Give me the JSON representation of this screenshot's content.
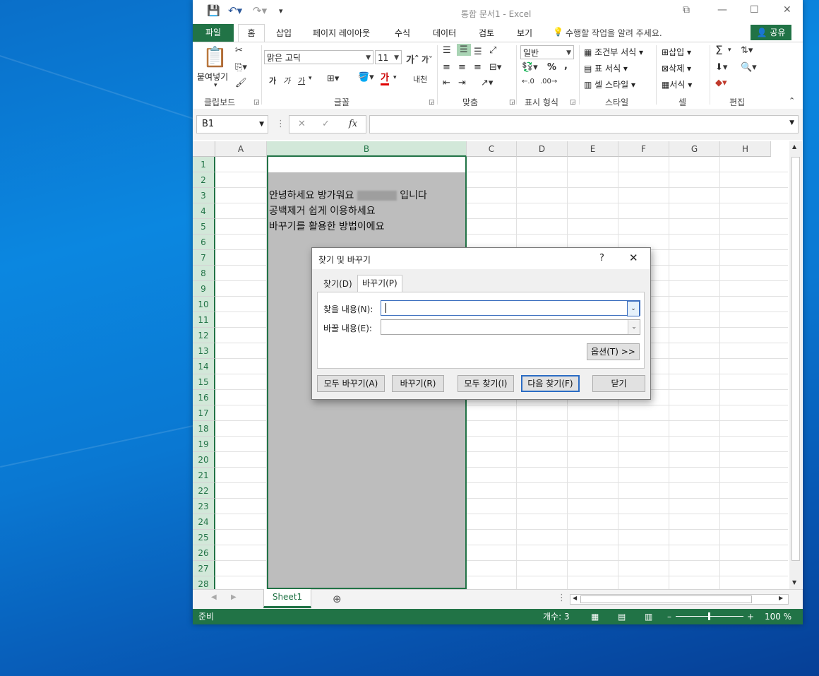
{
  "window": {
    "title": "통합 문서1 - Excel"
  },
  "ribbon_tabs": [
    "파일",
    "홈",
    "삽입",
    "페이지 레이아웃",
    "수식",
    "데이터",
    "검토",
    "보기"
  ],
  "tell_me": "수행할 작업을 알려 주세요.",
  "share_label": "공유",
  "clipboard": {
    "paste": "붙여넣기",
    "group": "클립보드"
  },
  "font": {
    "name": "맑은 고딕",
    "size": "11",
    "group": "글꼴",
    "bold": "가",
    "italic": "가",
    "underline": "가",
    "font_color": "가",
    "phonetic": "내천"
  },
  "alignment": {
    "group": "맞춤"
  },
  "number": {
    "format": "일반",
    "group": "표시 형식",
    "percent": "%",
    "comma": ","
  },
  "styles": {
    "conditional": "조건부 서식",
    "table": "표 서식",
    "cell": "셀 스타일",
    "group": "스타일"
  },
  "cells": {
    "insert": "삽입",
    "delete": "삭제",
    "format": "서식",
    "group": "셀"
  },
  "editing": {
    "group": "편집",
    "sigma": "Σ"
  },
  "formula_bar": {
    "name_box": "B1",
    "fx": "fx",
    "value": ""
  },
  "columns": [
    "A",
    "B",
    "C",
    "D",
    "E",
    "F",
    "G",
    "H"
  ],
  "rows": [
    "1",
    "2",
    "3",
    "4",
    "5",
    "6",
    "7",
    "8",
    "9",
    "10",
    "11",
    "12",
    "13",
    "14",
    "15",
    "16",
    "17",
    "18",
    "19",
    "20",
    "21",
    "22",
    "23",
    "24",
    "25",
    "26",
    "27",
    "28"
  ],
  "cells_text": {
    "b3_prefix": "안녕하세요 방가워요",
    "b3_suffix": "입니다",
    "b4": "공백제거 쉽게 이용하세요",
    "b5": "바꾸기를 활용한 방법이에요"
  },
  "sheet_tab": "Sheet1",
  "status": {
    "ready": "준비",
    "count": "개수: 3",
    "zoom": "100 %"
  },
  "dialog": {
    "title": "찾기 및 바꾸기",
    "help": "?",
    "tab_find": "찾기(D)",
    "tab_replace": "바꾸기(P)",
    "find_label": "찾을 내용(N):",
    "replace_label": "바꿀 내용(E):",
    "find_value": "",
    "replace_value": "",
    "options_btn": "옵션(T) >>",
    "replace_all_btn": "모두 바꾸기(A)",
    "replace_btn": "바꾸기(R)",
    "find_all_btn": "모두 찾기(I)",
    "find_next_btn": "다음 찾기(F)",
    "close_btn": "닫기"
  }
}
